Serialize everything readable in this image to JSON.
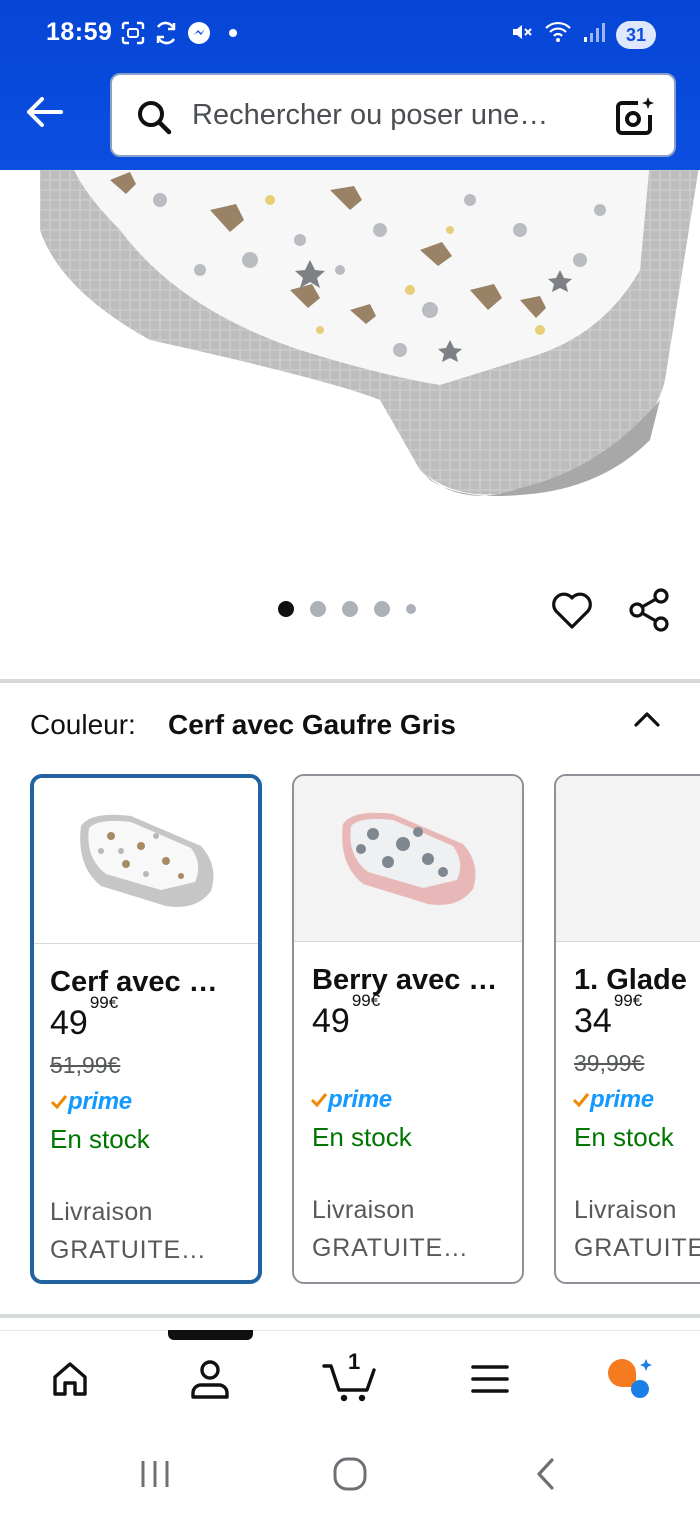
{
  "status_bar": {
    "time": "18:59",
    "battery": "31"
  },
  "header": {
    "search_placeholder": "Rechercher ou poser une…"
  },
  "carousel": {
    "dot_count": 5,
    "active_index": 0
  },
  "color_selector": {
    "label": "Couleur:",
    "selected_value": "Cerf avec Gaufre Gris"
  },
  "swatches": [
    {
      "title": "Cerf avec …",
      "price_whole": "49",
      "price_fraction": "99",
      "currency": "€",
      "old_price": "51,99€",
      "prime": "prime",
      "stock": "En stock",
      "delivery_line1": "Livraison",
      "delivery_line2": "GRATUITE…"
    },
    {
      "title": "Berry avec …",
      "price_whole": "49",
      "price_fraction": "99",
      "currency": "€",
      "old_price": "",
      "prime": "prime",
      "stock": "En stock",
      "delivery_line1": "Livraison",
      "delivery_line2": "GRATUITE…"
    },
    {
      "title": "1. Glade",
      "price_whole": "34",
      "price_fraction": "99",
      "currency": "€",
      "old_price": "39,99€",
      "prime": "prime",
      "stock": "En stock",
      "delivery_line1": "Livraison",
      "delivery_line2": "GRATUITE"
    }
  ],
  "bottom_nav": {
    "cart_count": "1",
    "items": [
      "home-icon",
      "account-icon",
      "cart-icon",
      "menu-icon",
      "rufus-icon"
    ]
  },
  "colors": {
    "header_blue": "#0b4ee0",
    "selected_border": "#2162a1",
    "prime_blue": "#1399ff",
    "prime_check": "#f08804",
    "stock_green": "#007600"
  }
}
